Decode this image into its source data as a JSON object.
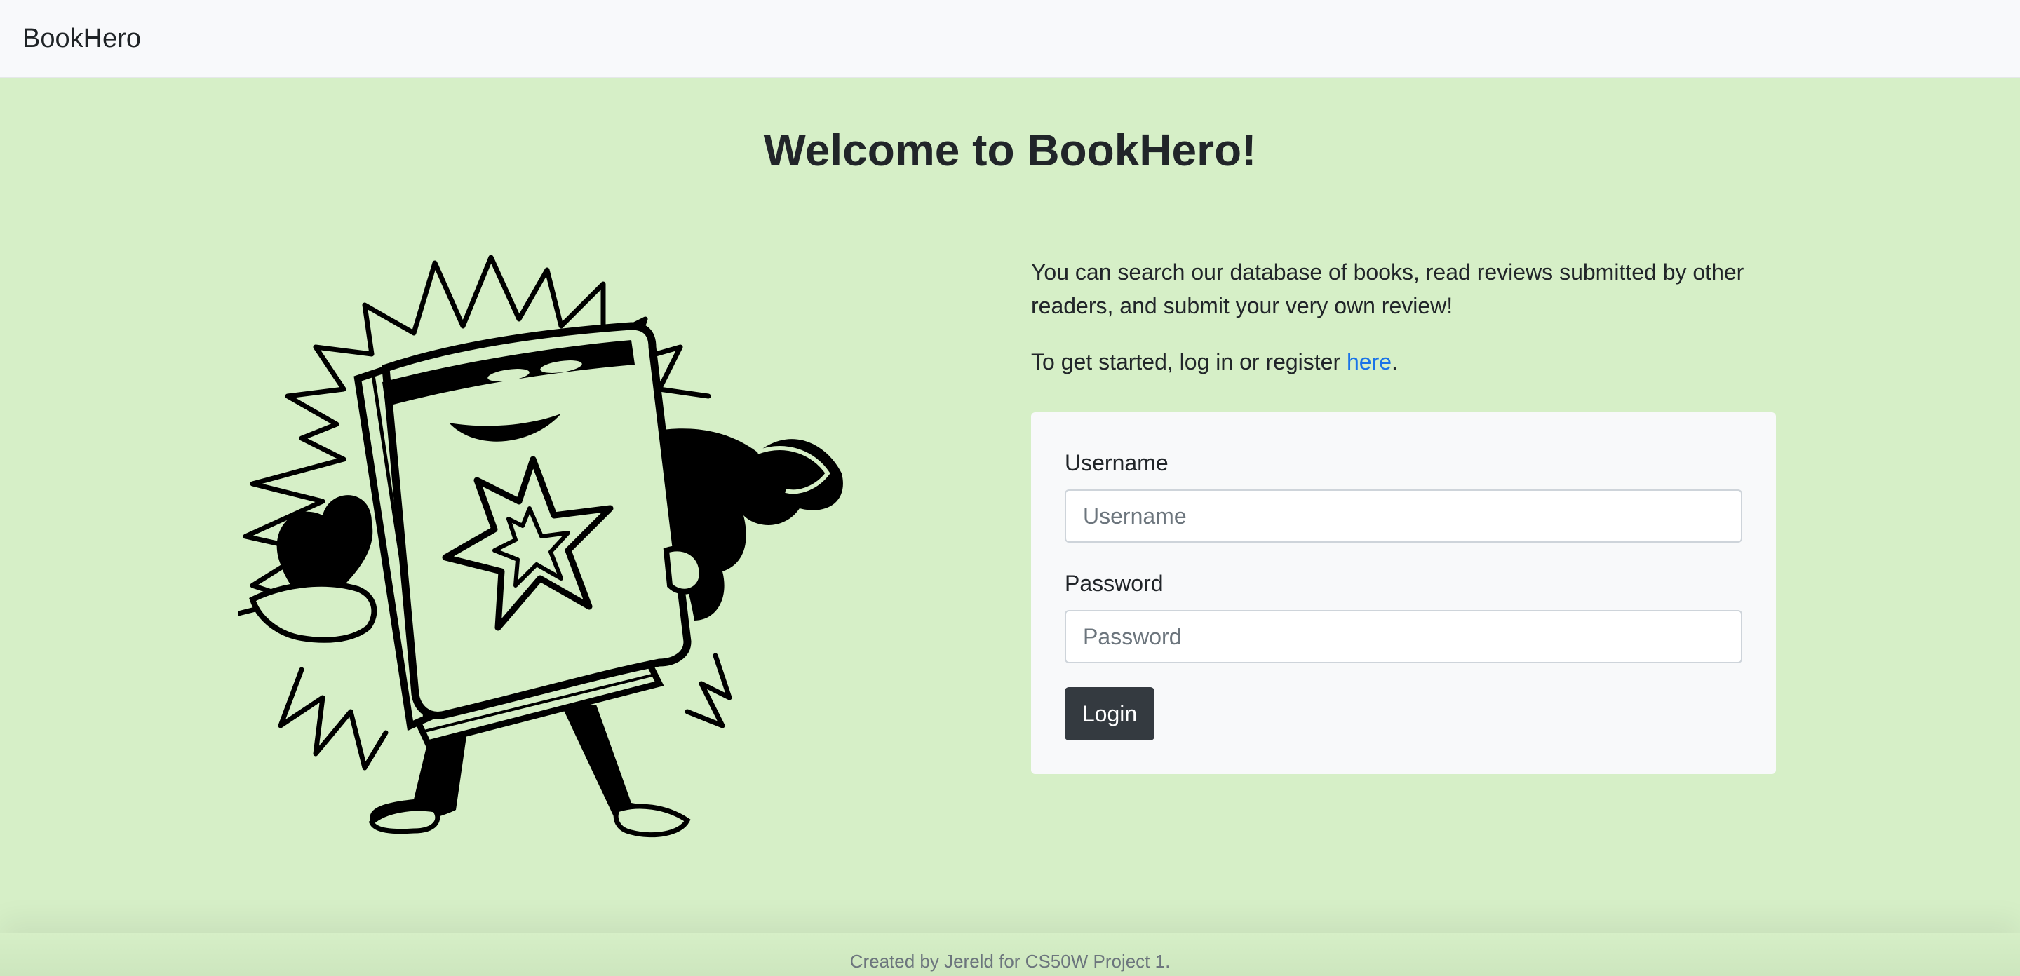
{
  "navbar": {
    "brand": "BookHero"
  },
  "main": {
    "title": "Welcome to BookHero!",
    "intro": "You can search our database of books, read reviews submitted by other readers, and submit your very own review!",
    "cta_prefix": "To get started, log in or register ",
    "cta_link": "here",
    "cta_suffix": "."
  },
  "login_form": {
    "username_label": "Username",
    "username_placeholder": "Username",
    "username_value": "",
    "password_label": "Password",
    "password_placeholder": "Password",
    "password_value": "",
    "submit_label": "Login"
  },
  "hero_image": {
    "icon": "book-superhero-illustration"
  },
  "footer": {
    "text": "Created by Jereld for CS50W Project 1."
  },
  "colors": {
    "page_background": "#d6efc7",
    "navbar_background": "#f8f9fb",
    "card_background": "#f8f9fa",
    "button_background": "#343a40",
    "link": "#1a73e8"
  }
}
